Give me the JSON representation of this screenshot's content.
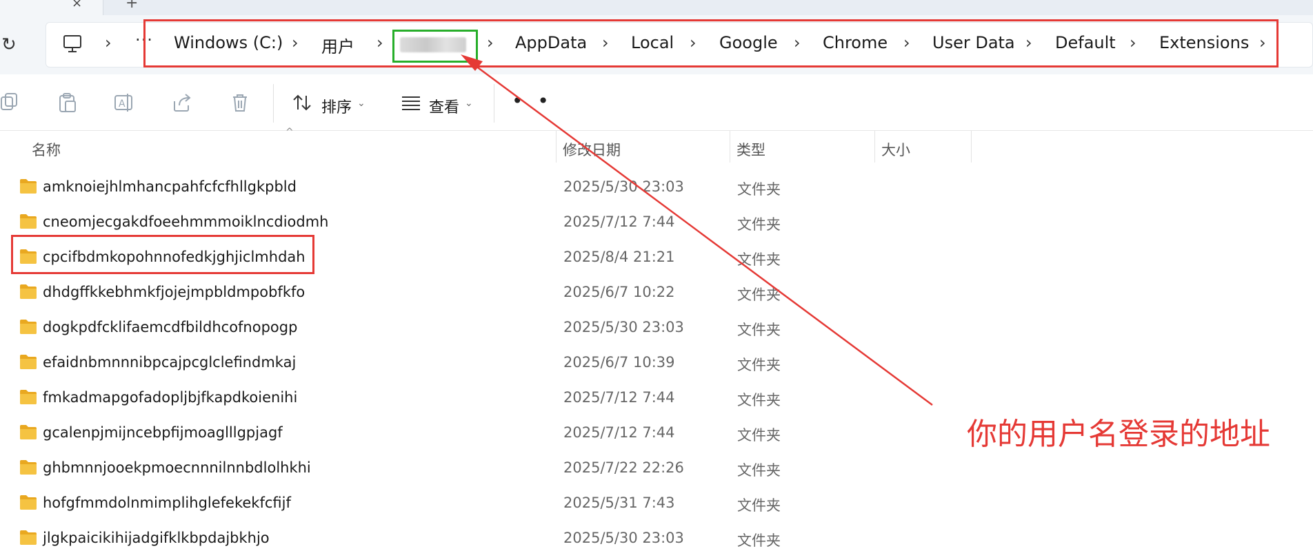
{
  "breadcrumb": {
    "items": [
      {
        "label": "Windows (C:)"
      },
      {
        "label": "用户"
      },
      {
        "label": "AppData"
      },
      {
        "label": "Local"
      },
      {
        "label": "Google"
      },
      {
        "label": "Chrome"
      },
      {
        "label": "User Data"
      },
      {
        "label": "Default"
      },
      {
        "label": "Extensions"
      }
    ],
    "overflow": "···"
  },
  "toolbar": {
    "sort_label": "排序",
    "view_label": "查看",
    "more": "• •"
  },
  "columns": {
    "name": "名称",
    "modified": "修改日期",
    "type": "类型",
    "size": "大小"
  },
  "files": [
    {
      "name": "amknoiejhlmhancpahfcfcfhllgkpbld",
      "date": "2025/5/30 23:03",
      "type": "文件夹"
    },
    {
      "name": "cneomjecgakdfoeehmmmoiklncdiodmh",
      "date": "2025/7/12 7:44",
      "type": "文件夹"
    },
    {
      "name": "cpcifbdmkopohnnofedkjghjiclmhdah",
      "date": "2025/8/4 21:21",
      "type": "文件夹"
    },
    {
      "name": "dhdgffkkebhmkfjojejmpbldmpobfkfo",
      "date": "2025/6/7 10:22",
      "type": "文件夹"
    },
    {
      "name": "dogkpdfcklifaemcdfbildhcofnopogp",
      "date": "2025/5/30 23:03",
      "type": "文件夹"
    },
    {
      "name": "efaidnbmnnnibpcajpcglclefindmkaj",
      "date": "2025/6/7 10:39",
      "type": "文件夹"
    },
    {
      "name": "fmkadmapgofadopljbjfkapdkoienihi",
      "date": "2025/7/12 7:44",
      "type": "文件夹"
    },
    {
      "name": "gcalenpjmijncebpfijmoaglllgpjagf",
      "date": "2025/7/12 7:44",
      "type": "文件夹"
    },
    {
      "name": "ghbmnnjooekpmoecnnnilnnbdlolhkhi",
      "date": "2025/7/22 22:26",
      "type": "文件夹"
    },
    {
      "name": "hofgfmmdolnmimplihglefekekfcfijf",
      "date": "2025/5/31 7:43",
      "type": "文件夹"
    },
    {
      "name": "jlgkpaicikihijadgifklkbpdajbkhjo",
      "date": "2025/5/30 23:03",
      "type": "文件夹"
    }
  ],
  "annotation": {
    "note": "你的用户名登录的地址",
    "color": "#e53935",
    "highlight_color": "#27ae2a"
  },
  "colors": {
    "folder": "#f5c342",
    "chrome_bg": "#f3f6f9"
  }
}
